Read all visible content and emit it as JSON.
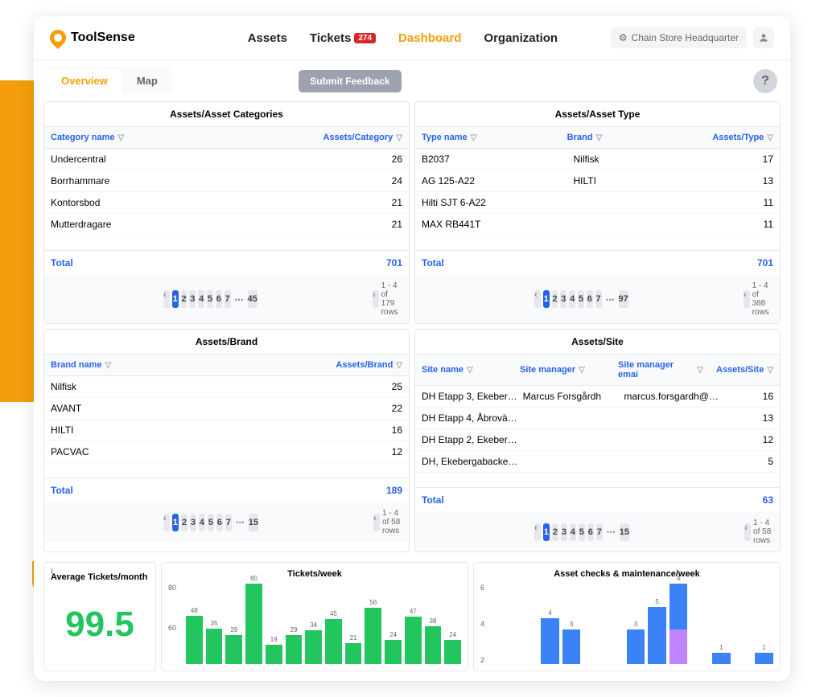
{
  "brand": "ToolSense",
  "nav": {
    "assets": "Assets",
    "tickets": "Tickets",
    "tickets_badge": "274",
    "dashboard": "Dashboard",
    "organization": "Organization"
  },
  "org_name": "Chain Store Headquarter",
  "tabs": {
    "overview": "Overview",
    "map": "Map"
  },
  "feedback": "Submit Feedback",
  "help": "?",
  "panels": {
    "cat": {
      "title": "Assets/Asset Categories",
      "cols": [
        "Category name",
        "Assets/Category"
      ],
      "rows": [
        [
          "Undercentral",
          "26"
        ],
        [
          "Borrhammare",
          "24"
        ],
        [
          "Kontorsbod",
          "21"
        ],
        [
          "Mutterdragare",
          "21"
        ]
      ],
      "total": "701",
      "last": "45",
      "info": "1 - 4 of 179 rows"
    },
    "type": {
      "title": "Assets/Asset Type",
      "cols": [
        "Type name",
        "Brand",
        "Assets/Type"
      ],
      "rows": [
        [
          "B2037",
          "Nilfisk",
          "17"
        ],
        [
          "AG 125-A22",
          "HILTI",
          "13"
        ],
        [
          "Hilti SJT 6-A22",
          "",
          "11"
        ],
        [
          "MAX RB441T",
          "",
          "11"
        ]
      ],
      "total": "701",
      "last": "97",
      "info": "1 - 4 of 388 rows"
    },
    "brand": {
      "title": "Assets/Brand",
      "cols": [
        "Brand name",
        "Assets/Brand"
      ],
      "rows": [
        [
          "Nilfisk",
          "25"
        ],
        [
          "AVANT",
          "22"
        ],
        [
          "HILTI",
          "16"
        ],
        [
          "PACVAC",
          "12"
        ]
      ],
      "total": "189",
      "last": "15",
      "info": "1 - 4 of 58 rows"
    },
    "site": {
      "title": "Assets/Site",
      "cols": [
        "Site name",
        "Site manager",
        "Site manager emai",
        "Assets/Site"
      ],
      "rows": [
        [
          "DH Etapp 3, Ekeber…",
          "Marcus Forsgårdh",
          "marcus.forsgardh@…",
          "16"
        ],
        [
          "DH Etapp 4, Åbrovä…",
          "",
          "",
          "13"
        ],
        [
          "DH Etapp 2, Ekeber…",
          "",
          "",
          "12"
        ],
        [
          "DH, Ekebergabacke…",
          "",
          "",
          "5"
        ]
      ],
      "total": "63",
      "last": "15",
      "info": "1 - 4 of 58 rows"
    }
  },
  "total_label": "Total",
  "pages": [
    "1",
    "2",
    "3",
    "4",
    "5",
    "6",
    "7"
  ],
  "kpi": {
    "label": "Average Tickets/month",
    "value": "99.5"
  },
  "chart_data": [
    {
      "type": "bar",
      "title": "Tickets/week",
      "ylim": [
        0,
        80
      ],
      "yticks": [
        80,
        60
      ],
      "values": [
        48,
        35,
        29,
        80,
        19,
        29,
        34,
        45,
        21,
        56,
        24,
        47,
        38,
        24
      ],
      "labels": [
        "48",
        "35",
        "29",
        "80",
        "19",
        "29",
        "34",
        "45",
        "21",
        "56",
        "24",
        "47",
        "38",
        "24"
      ]
    },
    {
      "type": "bar",
      "title": "Asset checks & maintenance/week",
      "ylim": [
        0,
        7
      ],
      "yticks": [
        6,
        4,
        2
      ],
      "series": [
        {
          "name": "blue",
          "values": [
            0,
            0,
            4,
            3,
            0,
            0,
            3,
            5,
            4,
            0,
            1,
            0,
            1
          ]
        },
        {
          "name": "purple",
          "values": [
            0,
            0,
            0,
            0,
            0,
            0,
            0,
            0,
            3,
            0,
            0,
            0,
            0
          ]
        }
      ],
      "labels": [
        "",
        "",
        "4",
        "3",
        "",
        "",
        "3",
        "5",
        "4",
        "",
        "1",
        "",
        "1"
      ]
    }
  ]
}
